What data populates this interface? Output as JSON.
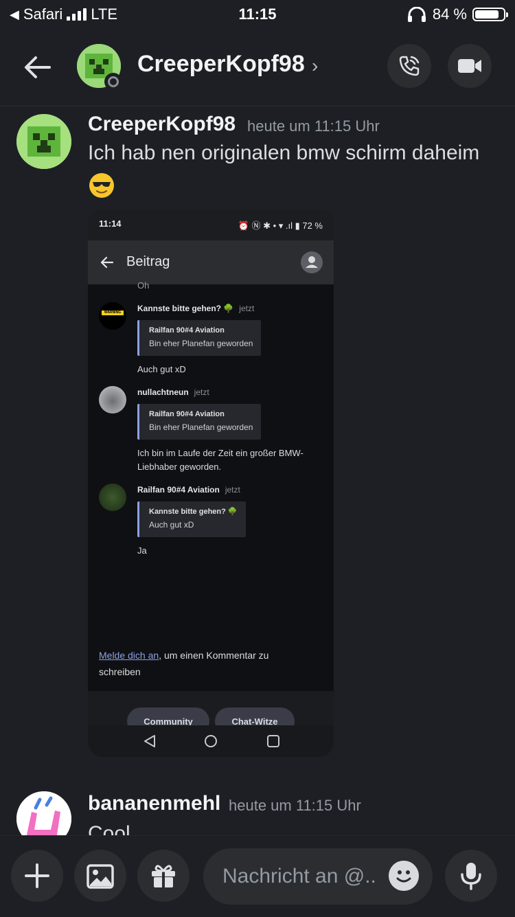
{
  "status_bar": {
    "carrier": "Safari",
    "network": "LTE",
    "time": "11:15",
    "battery_percent_label": "84 %",
    "battery_level": 0.84
  },
  "header": {
    "contact_name": "CreeperKopf98",
    "chevron": "›"
  },
  "messages": [
    {
      "author": "CreeperKopf98",
      "timestamp": "heute um 11:15 Uhr",
      "text": "Ich hab nen originalen bmw schirm daheim",
      "emoji": "smiling-face-with-sunglasses"
    },
    {
      "author": "bananenmehl",
      "timestamp": "heute um 11:15 Uhr",
      "text": "Cool"
    }
  ],
  "attachment": {
    "status_time": "11:14",
    "status_right": "⏰ Ⓝ ✱ • ▾ .ıl ▮ 72 %",
    "title": "Beitrag",
    "cut_text": "Oh",
    "comments": [
      {
        "author": "Kannste bitte gehen? 🌳",
        "time": "jetzt",
        "quote_author": "Railfan 90#4 Aviation",
        "quote_text": "Bin eher Planefan geworden",
        "text": "Auch gut xD",
        "avatar_label": "WARNING"
      },
      {
        "author": "nullachtneun",
        "time": "jetzt",
        "quote_author": "Railfan 90#4 Aviation",
        "quote_text": "Bin eher Planefan geworden",
        "text": "Ich bin im Laufe der Zeit ein großer BMW-Liebhaber geworden."
      },
      {
        "author": "Railfan 90#4 Aviation",
        "time": "jetzt",
        "quote_author": "Kannste bitte gehen? 🌳",
        "quote_text": "Auch gut xD",
        "text": "Ja"
      }
    ],
    "login_link": "Melde dich an",
    "login_rest": ", um einen Kommentar zu schreiben",
    "buttons": [
      "Community",
      "Chat-Witze"
    ]
  },
  "composer": {
    "placeholder": "Nachricht an @..",
    "icons": [
      "plus-icon",
      "image-icon",
      "gift-icon",
      "emoji-icon",
      "microphone-icon"
    ]
  },
  "colors": {
    "background": "#1e1f24",
    "surface": "#2b2d31",
    "link": "#8ea1e1",
    "avatar_green": "#8fd16a"
  }
}
